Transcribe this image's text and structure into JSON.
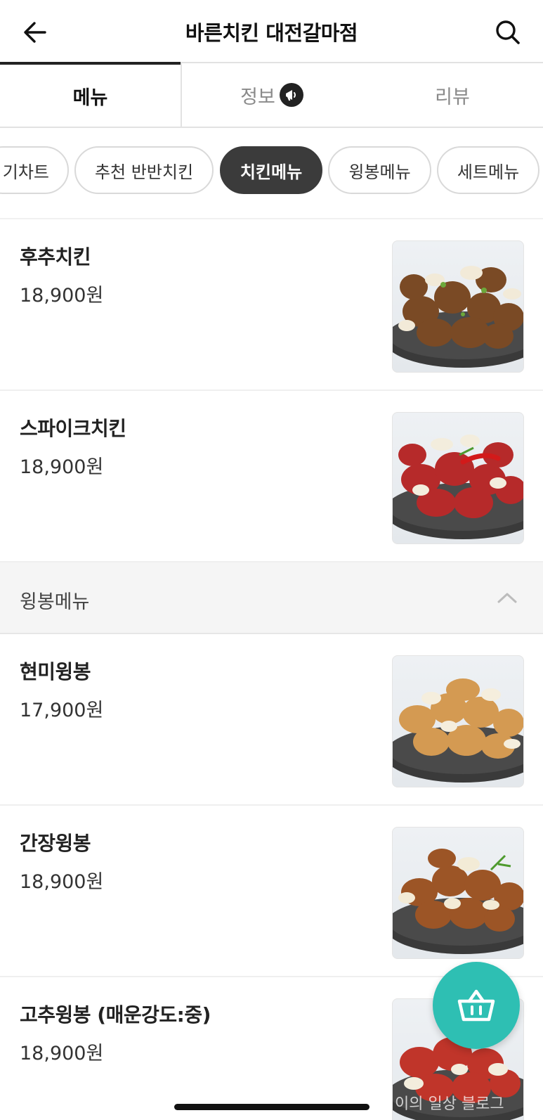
{
  "header": {
    "title": "바른치킨 대전갈마점",
    "back_icon": "arrow-left-icon",
    "search_icon": "search-icon"
  },
  "tabs": [
    {
      "label": "메뉴",
      "active": true
    },
    {
      "label": "정보",
      "active": false,
      "badge_icon": "megaphone-icon"
    },
    {
      "label": "리뷰",
      "active": false
    }
  ],
  "chips": [
    {
      "label": "기차트",
      "active": false
    },
    {
      "label": "추천 반반치킨",
      "active": false
    },
    {
      "label": "치킨메뉴",
      "active": true
    },
    {
      "label": "윙봉메뉴",
      "active": false
    },
    {
      "label": "세트메뉴",
      "active": false
    }
  ],
  "chicken_items": [
    {
      "name": "후추치킨",
      "price": "18,900원",
      "image": "pepper-chicken-photo"
    },
    {
      "name": "스파이크치킨",
      "price": "18,900원",
      "image": "spike-chicken-photo"
    }
  ],
  "section": {
    "title": "윙봉메뉴",
    "icon": "chevron-up-icon"
  },
  "wing_items": [
    {
      "name": "현미윙봉",
      "price": "17,900원",
      "image": "brown-rice-wings-photo"
    },
    {
      "name": "간장윙봉",
      "price": "18,900원",
      "image": "soy-wings-photo"
    },
    {
      "name": "고추윙봉 (매운강도:중)",
      "price": "18,900원",
      "image": "chili-wings-photo"
    }
  ],
  "fab": {
    "icon": "basket-icon"
  },
  "watermark": "이의 일상 블로그",
  "colors": {
    "accent": "#2ebfb3",
    "active_chip": "#3b3b3b",
    "section_bg": "#f5f5f5",
    "inactive_tab": "#8a8a8a"
  }
}
